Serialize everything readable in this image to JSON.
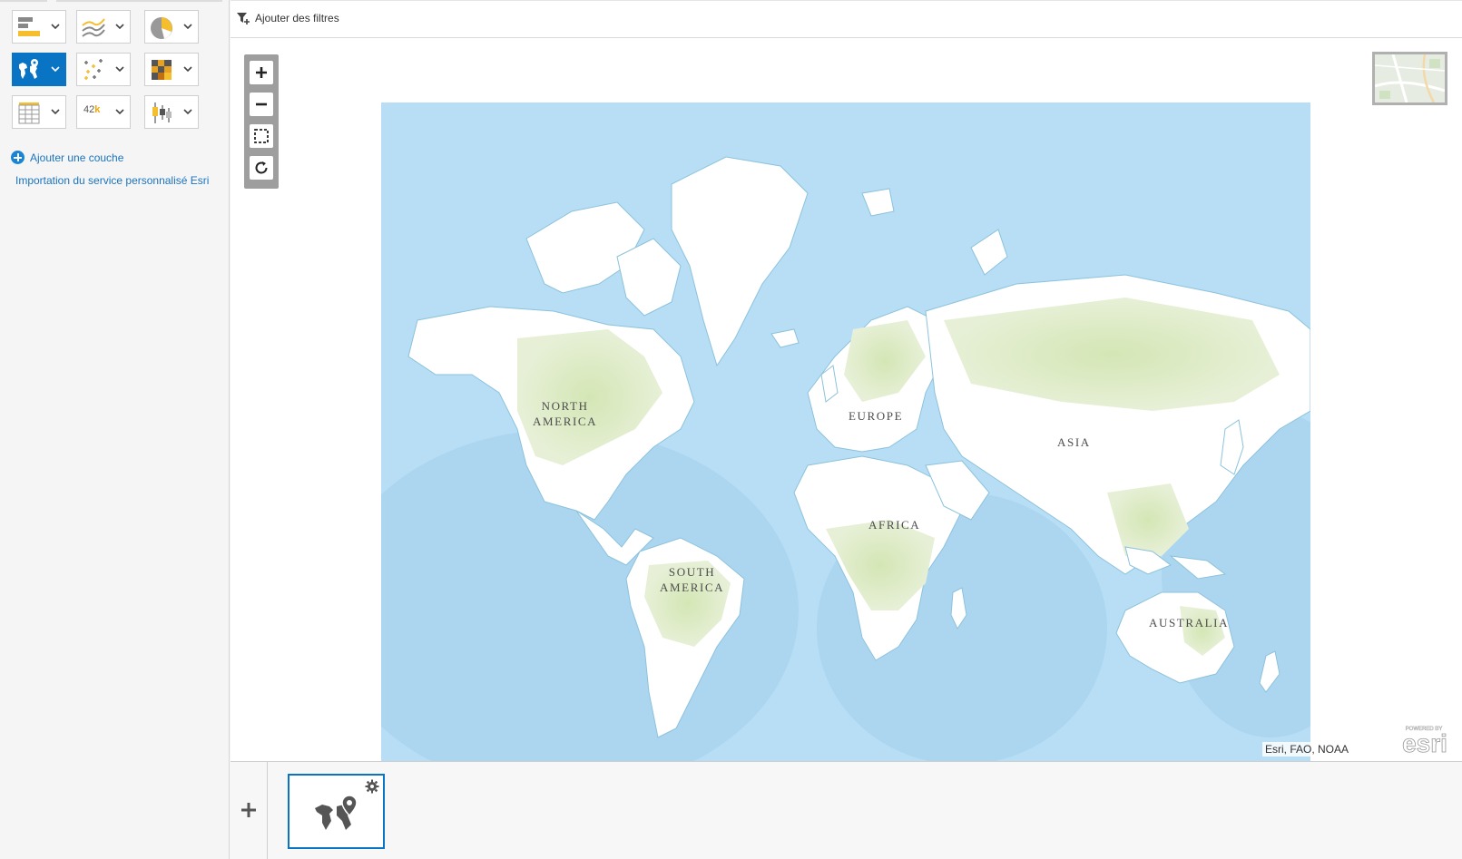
{
  "left_panel": {
    "viz_types": [
      {
        "icon": "bar-chart-icon",
        "active": false
      },
      {
        "icon": "line-chart-icon",
        "active": false
      },
      {
        "icon": "pie-chart-icon",
        "active": false
      },
      {
        "icon": "map-icon",
        "active": true
      },
      {
        "icon": "scatter-chart-icon",
        "active": false
      },
      {
        "icon": "heatmap-icon",
        "active": false
      },
      {
        "icon": "table-icon",
        "active": false
      },
      {
        "icon": "kpi-icon",
        "active": false,
        "kpi_number": "42",
        "kpi_suffix": "k"
      },
      {
        "icon": "boxplot-icon",
        "active": false
      }
    ],
    "add_layer_label": "Ajouter une couche",
    "import_label": "Importation du service personnalisé Esri"
  },
  "filter_bar": {
    "add_filters_label": "Ajouter des filtres"
  },
  "map": {
    "continents": [
      {
        "name": "NORTH\nAMERICA"
      },
      {
        "name": "EUROPE"
      },
      {
        "name": "ASIA"
      },
      {
        "name": "AFRICA"
      },
      {
        "name": "SOUTH\nAMERICA"
      },
      {
        "name": "AUSTRALIA"
      }
    ],
    "attribution": "Esri, FAO, NOAA",
    "logo_text": "esri",
    "logo_tagline": "POWERED BY"
  },
  "colors": {
    "accent": "#0a74c4",
    "ocean": "#b7def5",
    "land": "#ffffff",
    "vegetation": "#d9e8c2"
  }
}
